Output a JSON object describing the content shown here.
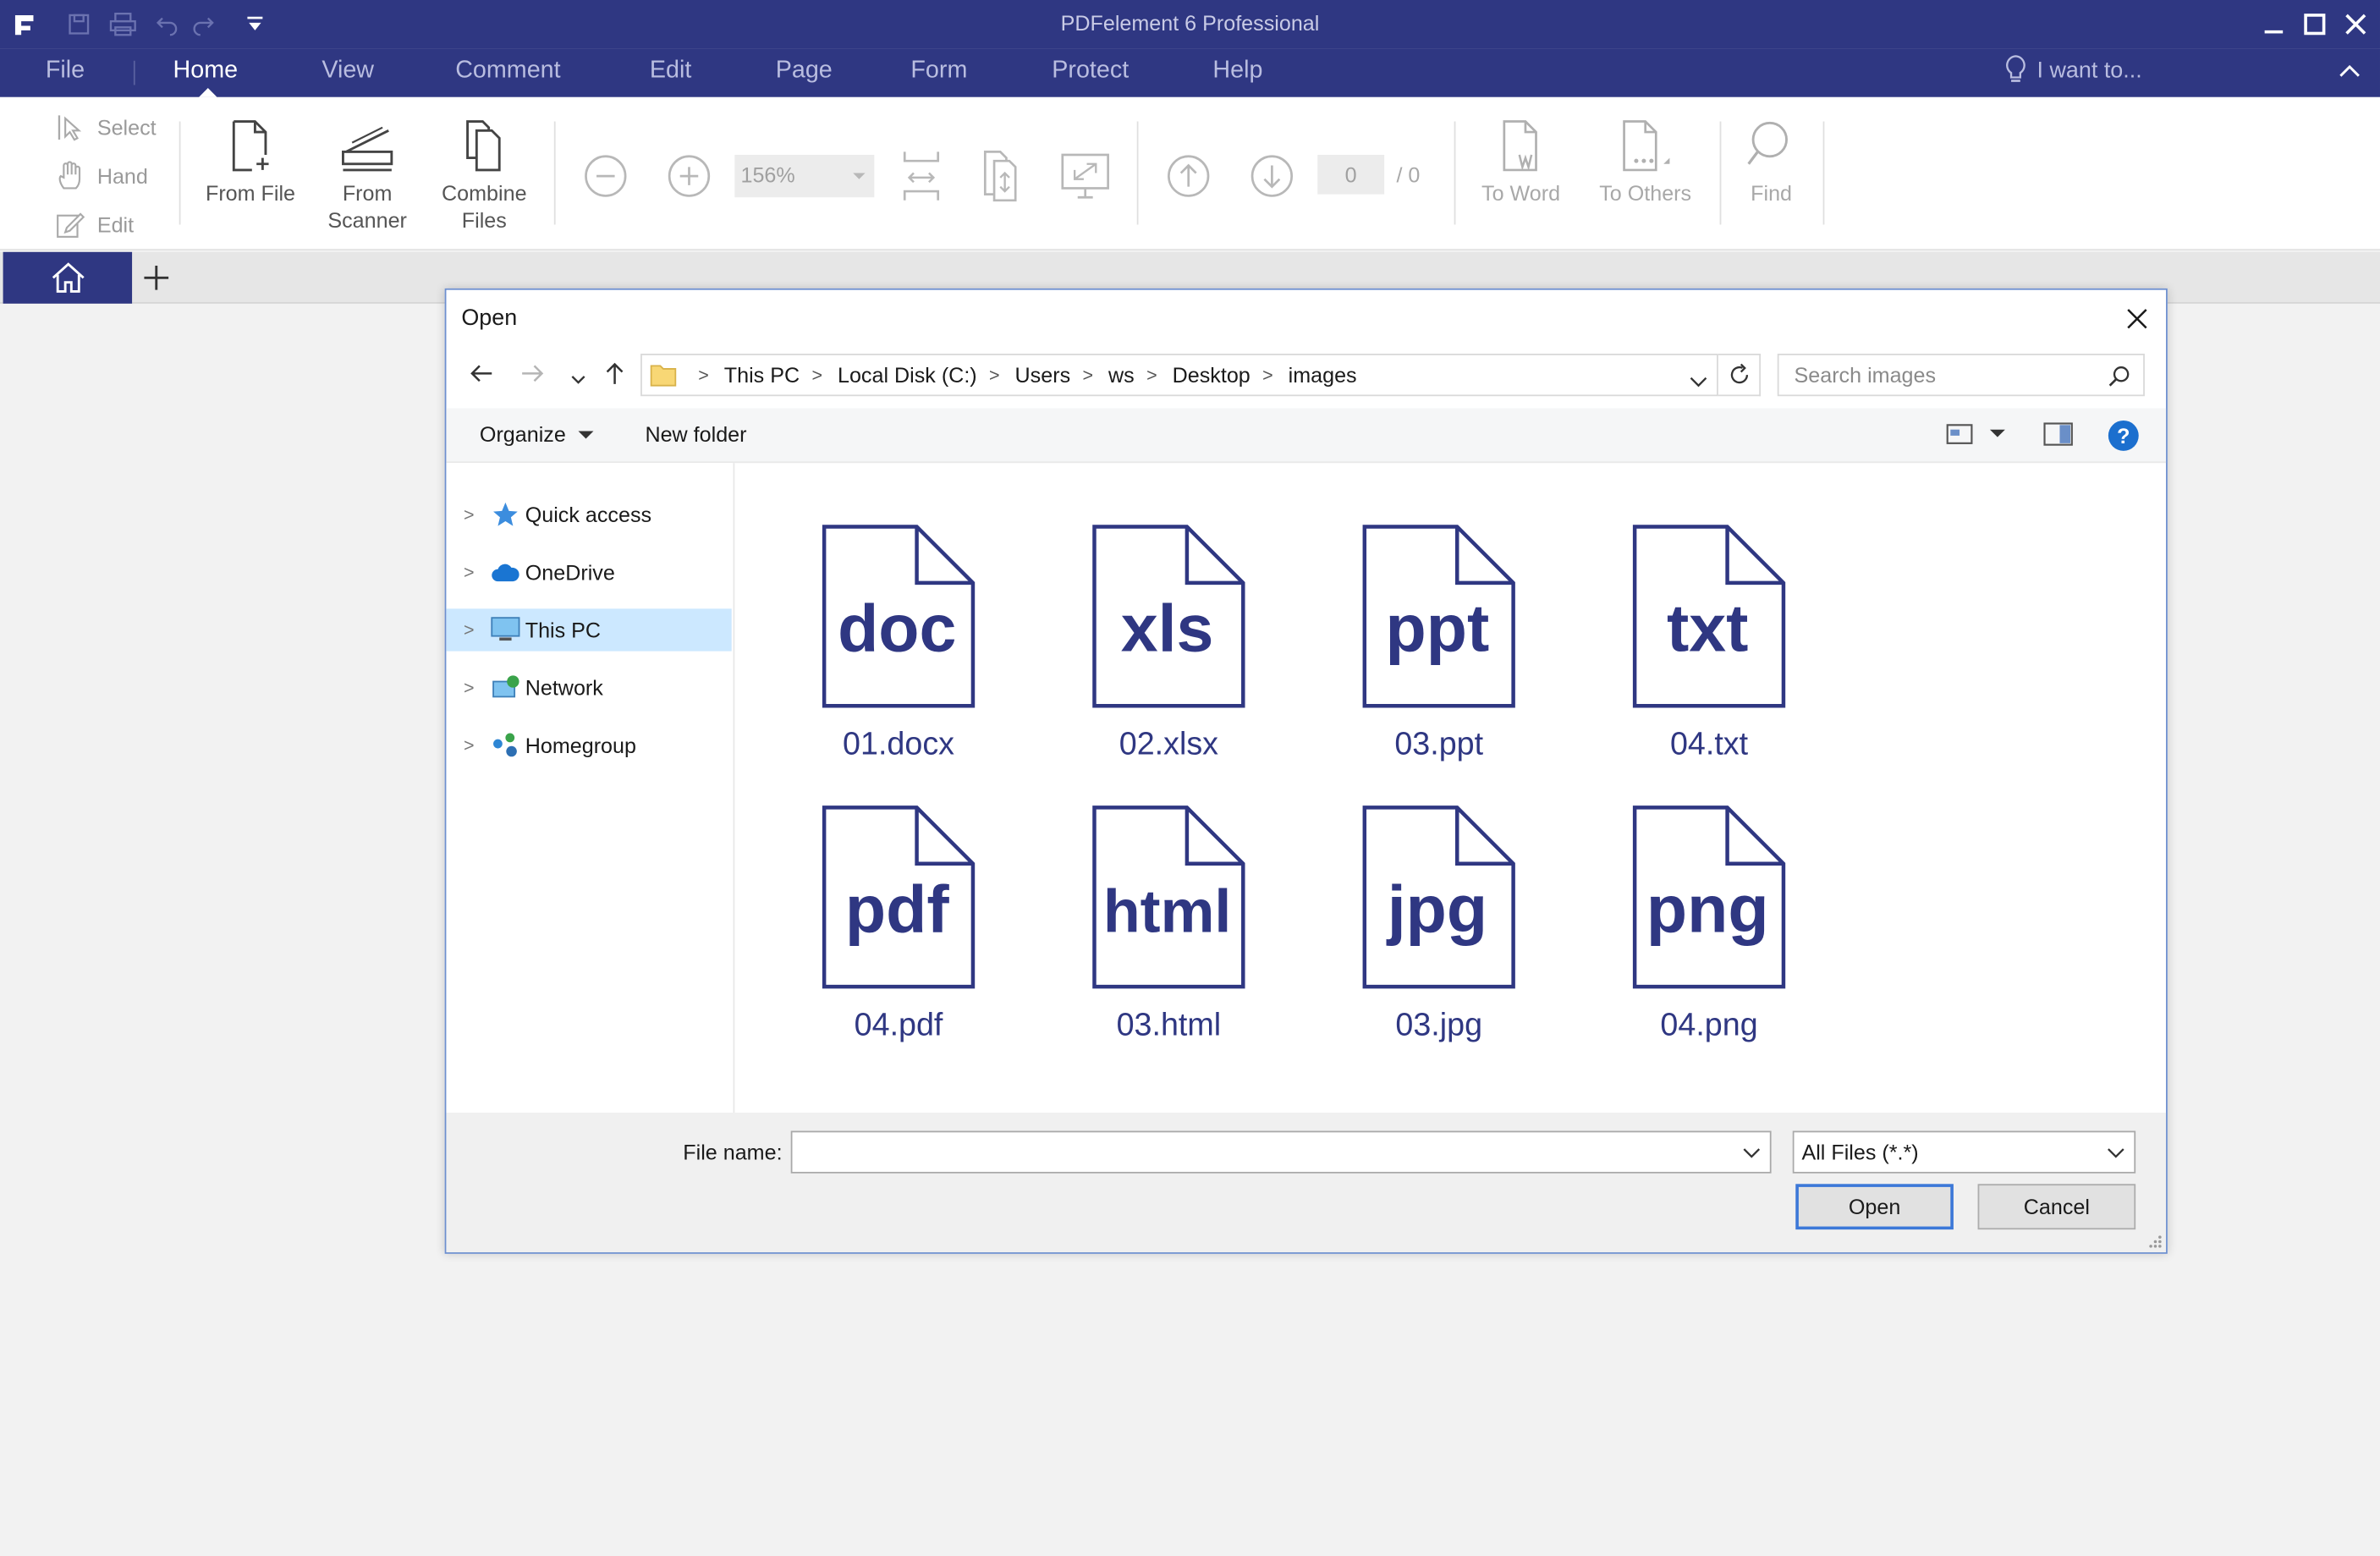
{
  "app": {
    "title": "PDFelement 6 Professional",
    "accent": "#2f3782"
  },
  "menu": {
    "items": [
      "File",
      "Home",
      "View",
      "Comment",
      "Edit",
      "Page",
      "Form",
      "Protect",
      "Help"
    ],
    "active": "Home",
    "i_want_to": "I want to..."
  },
  "ribbon": {
    "select": "Select",
    "hand": "Hand",
    "edit": "Edit",
    "from_file": "From File",
    "from_scanner_1": "From",
    "from_scanner_2": "Scanner",
    "combine_1": "Combine",
    "combine_2": "Files",
    "zoom": "156%",
    "page_current": "0",
    "page_total": "/ 0",
    "to_word": "To Word",
    "to_others": "To Others",
    "find": "Find"
  },
  "dialog": {
    "title": "Open",
    "breadcrumb": [
      "This PC",
      "Local Disk (C:)",
      "Users",
      "ws",
      "Desktop",
      "images"
    ],
    "search_placeholder": "Search images",
    "organize": "Organize",
    "new_folder": "New folder",
    "nav": [
      {
        "label": "Quick access",
        "icon": "star-icon"
      },
      {
        "label": "OneDrive",
        "icon": "cloud-icon"
      },
      {
        "label": "This PC",
        "icon": "computer-icon",
        "selected": true
      },
      {
        "label": "Network",
        "icon": "network-icon"
      },
      {
        "label": "Homegroup",
        "icon": "homegroup-icon"
      }
    ],
    "files": [
      {
        "ext": "doc",
        "name": "01.docx"
      },
      {
        "ext": "xls",
        "name": "02.xlsx"
      },
      {
        "ext": "ppt",
        "name": "03.ppt"
      },
      {
        "ext": "txt",
        "name": "04.txt"
      },
      {
        "ext": "pdf",
        "name": "04.pdf"
      },
      {
        "ext": "html",
        "name": "03.html"
      },
      {
        "ext": "jpg",
        "name": "03.jpg"
      },
      {
        "ext": "png",
        "name": "04.png"
      }
    ],
    "file_name_label": "File name:",
    "file_name_value": "",
    "file_type": "All Files (*.*)",
    "open": "Open",
    "cancel": "Cancel"
  }
}
